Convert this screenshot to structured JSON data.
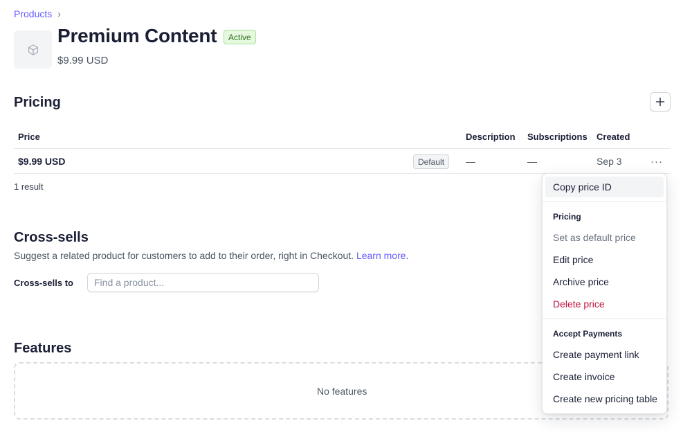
{
  "breadcrumb": {
    "label": "Products"
  },
  "product": {
    "title": "Premium Content",
    "status": "Active",
    "price_summary": "$9.99 USD"
  },
  "pricing": {
    "heading": "Pricing",
    "columns": {
      "price": "Price",
      "description": "Description",
      "subscriptions": "Subscriptions",
      "created": "Created"
    },
    "rows": [
      {
        "price": "$9.99 USD",
        "badge": "Default",
        "description": "—",
        "subscriptions": "—",
        "created": "Sep 3"
      }
    ],
    "result_count": "1 result"
  },
  "cross_sells": {
    "heading": "Cross-sells",
    "description": "Suggest a related product for customers to add to their order, right in Checkout.",
    "learn_more": "Learn more",
    "field_label": "Cross-sells to",
    "field_placeholder": "Find a product...",
    "field_value": ""
  },
  "features": {
    "heading": "Features",
    "empty_text": "No features"
  },
  "menu": {
    "copy_id": "Copy price ID",
    "section_pricing": "Pricing",
    "set_default": "Set as default price",
    "edit": "Edit price",
    "archive": "Archive price",
    "delete": "Delete price",
    "section_payments": "Accept Payments",
    "payment_link": "Create payment link",
    "invoice": "Create invoice",
    "pricing_table": "Create new pricing table"
  },
  "colors": {
    "accent": "#635bff",
    "danger": "#c0123c",
    "active_bg": "#e6f9df",
    "active_border": "#a6e39a"
  }
}
